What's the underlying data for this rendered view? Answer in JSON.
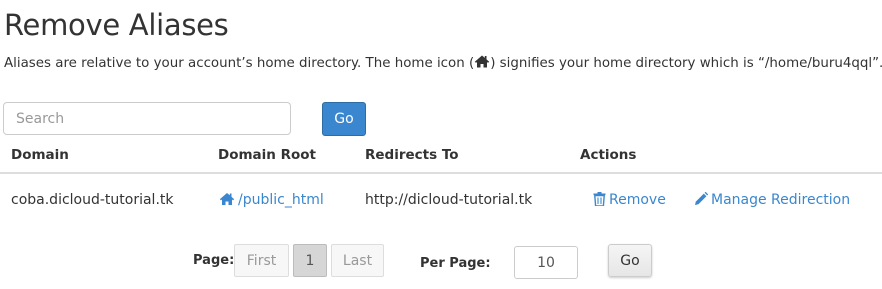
{
  "page": {
    "title": "Remove Aliases",
    "description_before": "Aliases are relative to your account’s home directory. The home icon (",
    "description_after": ") signifies your home directory which is “/home/buru4qql”."
  },
  "search": {
    "placeholder": "Search",
    "go_label": "Go"
  },
  "table": {
    "headers": [
      "Domain",
      "Domain Root",
      "Redirects To",
      "Actions"
    ],
    "rows": [
      {
        "domain": "coba.dicloud-tutorial.tk",
        "domain_root": "/public_html",
        "redirects_to": "http://dicloud-tutorial.tk",
        "remove_label": "Remove",
        "manage_label": "Manage Redirection"
      }
    ]
  },
  "pagination": {
    "page_label": "Page:",
    "first_label": "First",
    "current_page": "1",
    "last_label": "Last",
    "per_page_label": "Per Page:",
    "per_page_value": "10",
    "go_label": "Go"
  },
  "colors": {
    "primary": "#3a87cf",
    "text": "#333333",
    "border": "#dddddd"
  },
  "icons": [
    "home-icon",
    "trash-icon",
    "pencil-icon"
  ]
}
